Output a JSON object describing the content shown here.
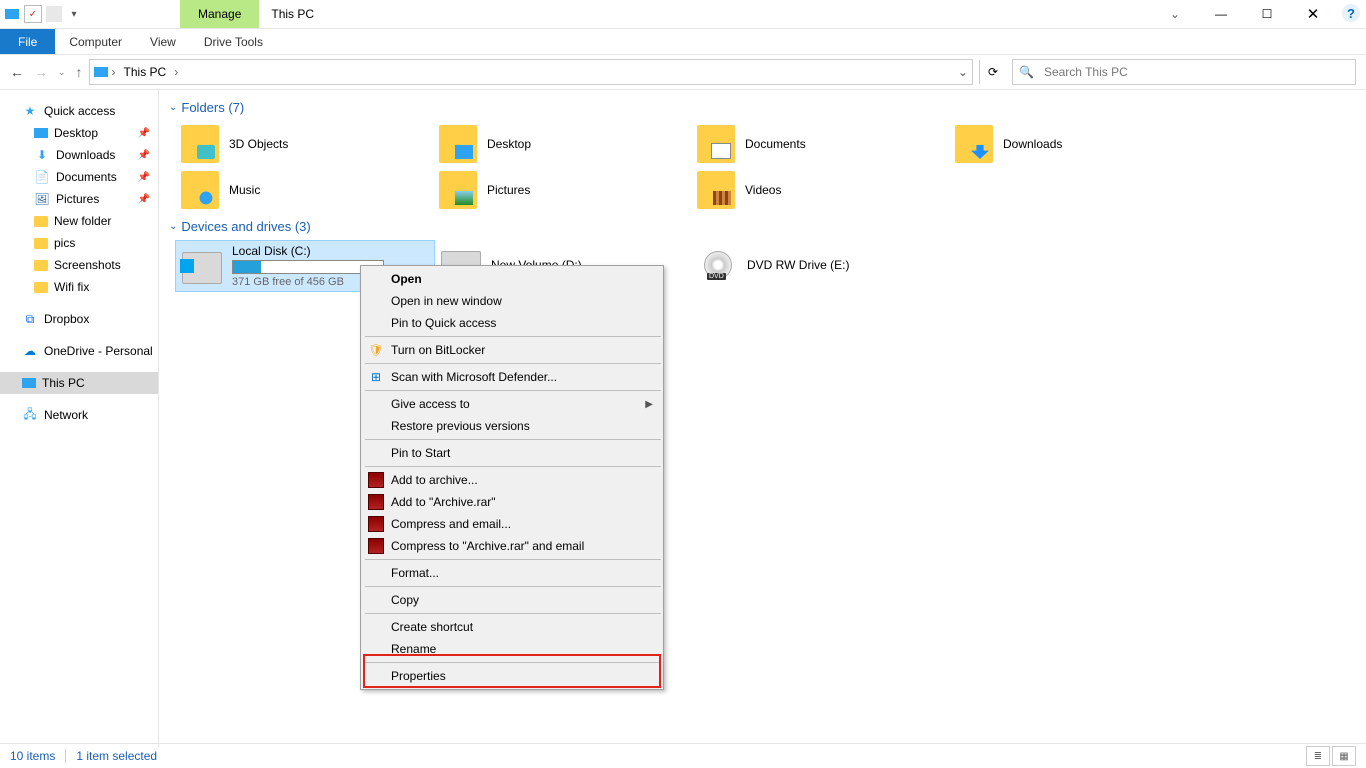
{
  "window": {
    "manage_tab": "Manage",
    "title": "This PC",
    "drive_tools": "Drive Tools"
  },
  "ribbon": {
    "file": "File",
    "computer": "Computer",
    "view": "View"
  },
  "address": {
    "location": "This PC",
    "search_placeholder": "Search This PC"
  },
  "sidebar": {
    "quick": "Quick access",
    "desktop": "Desktop",
    "downloads": "Downloads",
    "documents": "Documents",
    "pictures": "Pictures",
    "newfolder": "New folder",
    "pics": "pics",
    "screenshots": "Screenshots",
    "wifi": "Wifi fix",
    "dropbox": "Dropbox",
    "onedrive": "OneDrive - Personal",
    "thispc": "This PC",
    "network": "Network"
  },
  "groups": {
    "folders": "Folders (7)",
    "drives": "Devices and drives (3)"
  },
  "tiles": {
    "obj3d": "3D Objects",
    "desktop": "Desktop",
    "documents": "Documents",
    "downloads": "Downloads",
    "music": "Music",
    "pictures": "Pictures",
    "videos": "Videos"
  },
  "drives": {
    "c_name": "Local Disk (C:)",
    "c_sub": "371 GB free of 456 GB",
    "d_name": "New Volume (D:)",
    "e_name": "DVD RW Drive (E:)"
  },
  "ctx": {
    "open": "Open",
    "open_new": "Open in new window",
    "pin_quick": "Pin to Quick access",
    "bitlocker": "Turn on BitLocker",
    "defender": "Scan with Microsoft Defender...",
    "give_access": "Give access to",
    "restore": "Restore previous versions",
    "pin_start": "Pin to Start",
    "add_archive": "Add to archive...",
    "add_rar": "Add to \"Archive.rar\"",
    "compress_email": "Compress and email...",
    "compress_rar_email": "Compress to \"Archive.rar\" and email",
    "format": "Format...",
    "copy": "Copy",
    "shortcut": "Create shortcut",
    "rename": "Rename",
    "properties": "Properties"
  },
  "status": {
    "items": "10 items",
    "selected": "1 item selected"
  }
}
